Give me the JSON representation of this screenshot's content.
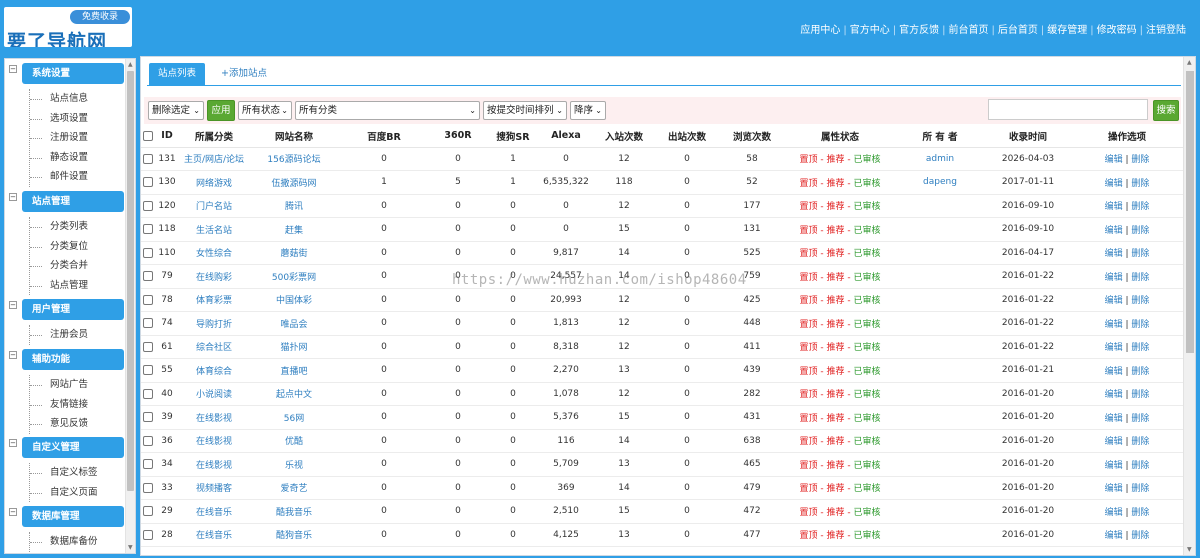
{
  "logo": {
    "badge": "免费收录",
    "wordmark": "要了导航网"
  },
  "topnav": [
    "应用中心",
    "官方中心",
    "官方反馈",
    "前台首页",
    "后台首页",
    "缓存管理",
    "修改密码",
    "注销登陆"
  ],
  "sidebar": {
    "groups": [
      {
        "title": "系统设置",
        "items": [
          "站点信息",
          "选项设置",
          "注册设置",
          "静态设置",
          "邮件设置"
        ]
      },
      {
        "title": "站点管理",
        "items": [
          "分类列表",
          "分类复位",
          "分类合并",
          "站点管理"
        ]
      },
      {
        "title": "用户管理",
        "items": [
          "注册会员"
        ]
      },
      {
        "title": "辅助功能",
        "items": [
          "网站广告",
          "友情链接",
          "意见反馈"
        ]
      },
      {
        "title": "自定义管理",
        "items": [
          "自定义标签",
          "自定义页面"
        ]
      },
      {
        "title": "数据库管理",
        "items": [
          "数据库备份"
        ]
      }
    ]
  },
  "tabs": {
    "active": "站点列表",
    "add": "+添加站点"
  },
  "filters": {
    "action": "删除选定",
    "apply": "应用",
    "status": "所有状态",
    "category": "所有分类",
    "sort": "按提交时间排列",
    "order": "降序",
    "search_button": "搜索",
    "search_value": ""
  },
  "table": {
    "headers": [
      "ID",
      "所属分类",
      "网站名称",
      "百度BR",
      "360R",
      "搜狗SR",
      "Alexa",
      "入站次数",
      "出站次数",
      "浏览次数",
      "属性状态",
      "所 有 者",
      "收录时间",
      "操作选项"
    ],
    "status": {
      "top": "置顶",
      "recommend": "推荐",
      "approved": "已审核",
      "dash": " - "
    },
    "ops": {
      "edit": "编辑",
      "sep": " | ",
      "delete": "删除"
    },
    "rows": [
      {
        "id": "131",
        "cat": "主页/网店/论坛",
        "name": "156源码论坛",
        "br": "0",
        "r360": "0",
        "sr": "1",
        "alexa": "0",
        "in": "12",
        "out": "0",
        "views": "58",
        "owner": "admin",
        "date": "2026-04-03"
      },
      {
        "id": "130",
        "cat": "网络游戏",
        "name": "伍撒源码网",
        "br": "1",
        "r360": "5",
        "sr": "1",
        "alexa": "6,535,322",
        "in": "118",
        "out": "0",
        "views": "52",
        "owner": "dapeng",
        "date": "2017-01-11"
      },
      {
        "id": "120",
        "cat": "门户名站",
        "name": "腾讯",
        "br": "0",
        "r360": "0",
        "sr": "0",
        "alexa": "0",
        "in": "12",
        "out": "0",
        "views": "177",
        "owner": "",
        "date": "2016-09-10"
      },
      {
        "id": "118",
        "cat": "生活名站",
        "name": "赶集",
        "br": "0",
        "r360": "0",
        "sr": "0",
        "alexa": "0",
        "in": "15",
        "out": "0",
        "views": "131",
        "owner": "",
        "date": "2016-09-10"
      },
      {
        "id": "110",
        "cat": "女性综合",
        "name": "蘑菇街",
        "br": "0",
        "r360": "0",
        "sr": "0",
        "alexa": "9,817",
        "in": "14",
        "out": "0",
        "views": "525",
        "owner": "",
        "date": "2016-04-17"
      },
      {
        "id": "79",
        "cat": "在线购彩",
        "name": "500彩票网",
        "br": "0",
        "r360": "0",
        "sr": "0",
        "alexa": "24,557",
        "in": "14",
        "out": "0",
        "views": "759",
        "owner": "",
        "date": "2016-01-22"
      },
      {
        "id": "78",
        "cat": "体育彩票",
        "name": "中国体彩",
        "br": "0",
        "r360": "0",
        "sr": "0",
        "alexa": "20,993",
        "in": "12",
        "out": "0",
        "views": "425",
        "owner": "",
        "date": "2016-01-22"
      },
      {
        "id": "74",
        "cat": "导购打折",
        "name": "唯品会",
        "br": "0",
        "r360": "0",
        "sr": "0",
        "alexa": "1,813",
        "in": "12",
        "out": "0",
        "views": "448",
        "owner": "",
        "date": "2016-01-22"
      },
      {
        "id": "61",
        "cat": "综合社区",
        "name": "猫扑网",
        "br": "0",
        "r360": "0",
        "sr": "0",
        "alexa": "8,318",
        "in": "12",
        "out": "0",
        "views": "411",
        "owner": "",
        "date": "2016-01-22"
      },
      {
        "id": "55",
        "cat": "体育综合",
        "name": "直播吧",
        "br": "0",
        "r360": "0",
        "sr": "0",
        "alexa": "2,270",
        "in": "13",
        "out": "0",
        "views": "439",
        "owner": "",
        "date": "2016-01-21"
      },
      {
        "id": "40",
        "cat": "小说阅读",
        "name": "起点中文",
        "br": "0",
        "r360": "0",
        "sr": "0",
        "alexa": "1,078",
        "in": "12",
        "out": "0",
        "views": "282",
        "owner": "",
        "date": "2016-01-20"
      },
      {
        "id": "39",
        "cat": "在线影视",
        "name": "56网",
        "br": "0",
        "r360": "0",
        "sr": "0",
        "alexa": "5,376",
        "in": "15",
        "out": "0",
        "views": "431",
        "owner": "",
        "date": "2016-01-20"
      },
      {
        "id": "36",
        "cat": "在线影视",
        "name": "优酷",
        "br": "0",
        "r360": "0",
        "sr": "0",
        "alexa": "116",
        "in": "14",
        "out": "0",
        "views": "638",
        "owner": "",
        "date": "2016-01-20"
      },
      {
        "id": "34",
        "cat": "在线影视",
        "name": "乐视",
        "br": "0",
        "r360": "0",
        "sr": "0",
        "alexa": "5,709",
        "in": "13",
        "out": "0",
        "views": "465",
        "owner": "",
        "date": "2016-01-20"
      },
      {
        "id": "33",
        "cat": "视频播客",
        "name": "爱奇艺",
        "br": "0",
        "r360": "0",
        "sr": "0",
        "alexa": "369",
        "in": "14",
        "out": "0",
        "views": "479",
        "owner": "",
        "date": "2016-01-20"
      },
      {
        "id": "29",
        "cat": "在线音乐",
        "name": "酷我音乐",
        "br": "0",
        "r360": "0",
        "sr": "0",
        "alexa": "2,510",
        "in": "15",
        "out": "0",
        "views": "472",
        "owner": "",
        "date": "2016-01-20"
      },
      {
        "id": "28",
        "cat": "在线音乐",
        "name": "酷狗音乐",
        "br": "0",
        "r360": "0",
        "sr": "0",
        "alexa": "4,125",
        "in": "13",
        "out": "0",
        "views": "477",
        "owner": "",
        "date": "2016-01-20"
      }
    ]
  },
  "watermark": "https://www.huzhan.com/ishop48604",
  "colors": {
    "brand": "#2f9fe6",
    "link": "#2f7fc0",
    "danger": "#e01f1f",
    "success": "#2f9a2f",
    "button": "#5aa832"
  }
}
